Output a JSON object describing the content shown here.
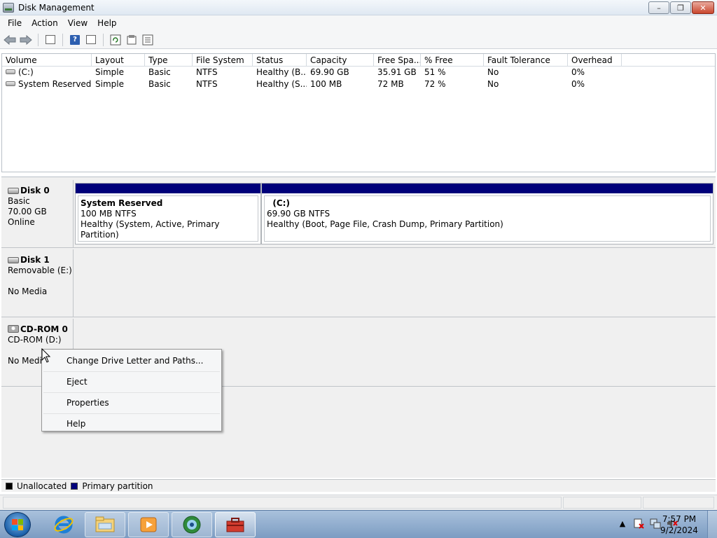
{
  "window": {
    "title": "Disk Management",
    "buttons": {
      "minimize": "–",
      "maximize": "❐",
      "close": "✕"
    }
  },
  "menubar": {
    "items": [
      "File",
      "Action",
      "View",
      "Help"
    ]
  },
  "toolbar": {
    "icons": [
      "back-arrow-icon",
      "forward-arrow-icon",
      "console-tree-icon",
      "help-icon",
      "action-pane-icon",
      "refresh-icon",
      "properties-icon",
      "export-list-icon"
    ],
    "help_glyph": "?"
  },
  "volume_list": {
    "columns": [
      "Volume",
      "Layout",
      "Type",
      "File System",
      "Status",
      "Capacity",
      "Free Spa...",
      "% Free",
      "Fault Tolerance",
      "Overhead"
    ],
    "rows": [
      [
        "(C:)",
        "Simple",
        "Basic",
        "NTFS",
        "Healthy (B...",
        "69.90 GB",
        "35.91 GB",
        "51 %",
        "No",
        "0%"
      ],
      [
        "System Reserved",
        "Simple",
        "Basic",
        "NTFS",
        "Healthy (S...",
        "100 MB",
        "72 MB",
        "72 %",
        "No",
        "0%"
      ]
    ]
  },
  "disks": [
    {
      "name": "Disk 0",
      "lines": [
        "Basic",
        "70.00 GB",
        "Online"
      ],
      "partitions": [
        {
          "name": "System Reserved",
          "size": "100 MB NTFS",
          "status": "Healthy (System, Active, Primary Partition)"
        },
        {
          "name": "(C:)",
          "size": "69.90 GB NTFS",
          "status": "Healthy (Boot, Page File, Crash Dump, Primary Partition)"
        }
      ]
    },
    {
      "name": "Disk 1",
      "lines": [
        "Removable (E:)",
        "",
        "No Media"
      ]
    },
    {
      "name": "CD-ROM 0",
      "lines": [
        "CD-ROM (D:)",
        "",
        "No Media"
      ]
    }
  ],
  "legend": {
    "items": [
      {
        "label": "Unallocated",
        "color": "#000000"
      },
      {
        "label": "Primary partition",
        "color": "#00007a"
      }
    ]
  },
  "context_menu": {
    "items": [
      "Change Drive Letter and Paths...",
      "Eject",
      "Properties",
      "Help"
    ]
  },
  "taskbar": {
    "apps": [
      "internet-explorer-icon",
      "windows-explorer-icon",
      "media-player-icon",
      "windows-media-center-icon",
      "computer-management-icon"
    ],
    "clock_time": "7:57 PM",
    "clock_date": "9/2/2024",
    "tray_icons": [
      "show-hidden-icons-arrow",
      "action-center-icon",
      "network-icon",
      "volume-muted-icon"
    ]
  },
  "colors": {
    "primary_partition": "#00007a",
    "titlebar": "#dfe8f2",
    "taskbar": "#7c9cc2"
  }
}
